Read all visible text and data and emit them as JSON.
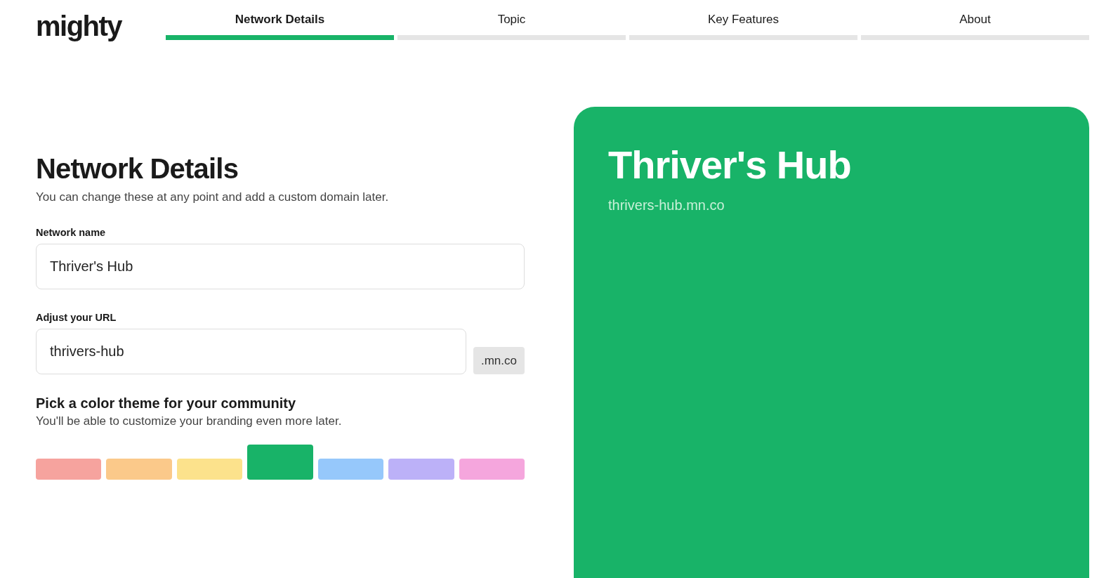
{
  "logo": "mighty",
  "steps": [
    {
      "label": "Network Details",
      "selected": true
    },
    {
      "label": "Topic",
      "selected": false
    },
    {
      "label": "Key Features",
      "selected": false
    },
    {
      "label": "About",
      "selected": false
    }
  ],
  "form": {
    "title": "Network Details",
    "subtitle": "You can change these at any point and add a custom domain later.",
    "name_field": {
      "label": "Network name",
      "value": "Thriver's Hub"
    },
    "url_field": {
      "label": "Adjust your URL",
      "value": "thrivers-hub",
      "suffix": ".mn.co"
    },
    "theme": {
      "title": "Pick a color theme for your community",
      "subtitle": "You'll be able to customize your branding even more later.",
      "swatches": [
        {
          "color": "#f6a39e",
          "selected": false
        },
        {
          "color": "#fbc98a",
          "selected": false
        },
        {
          "color": "#fce28c",
          "selected": false
        },
        {
          "color": "#18b368",
          "selected": true
        },
        {
          "color": "#96c8fb",
          "selected": false
        },
        {
          "color": "#bcb1f8",
          "selected": false
        },
        {
          "color": "#f5a6dd",
          "selected": false
        }
      ]
    }
  },
  "preview": {
    "title": "Thriver's Hub",
    "url": "thrivers-hub.mn.co"
  }
}
